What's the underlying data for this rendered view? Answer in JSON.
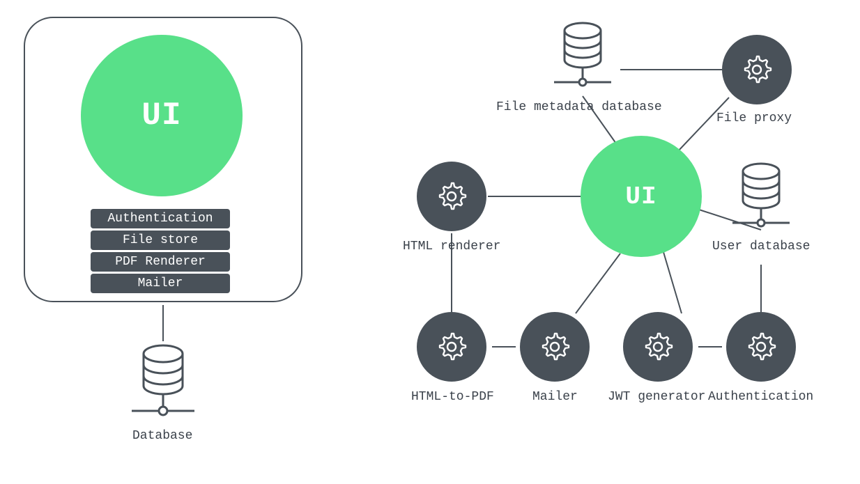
{
  "colors": {
    "accent_green": "#58e089",
    "node_dark": "#495159",
    "stroke": "#495159",
    "white": "#ffffff"
  },
  "left": {
    "ui_label": "UI",
    "stack": [
      "Authentication",
      "File store",
      "PDF Renderer",
      "Mailer"
    ],
    "database_label": "Database"
  },
  "right": {
    "ui_label": "UI",
    "nodes": {
      "file_metadata_db": "File metadata database",
      "file_proxy": "File proxy",
      "html_renderer": "HTML renderer",
      "user_db": "User database",
      "html_to_pdf": "HTML-to-PDF",
      "mailer": "Mailer",
      "jwt_generator": "JWT generator",
      "authentication": "Authentication"
    }
  }
}
